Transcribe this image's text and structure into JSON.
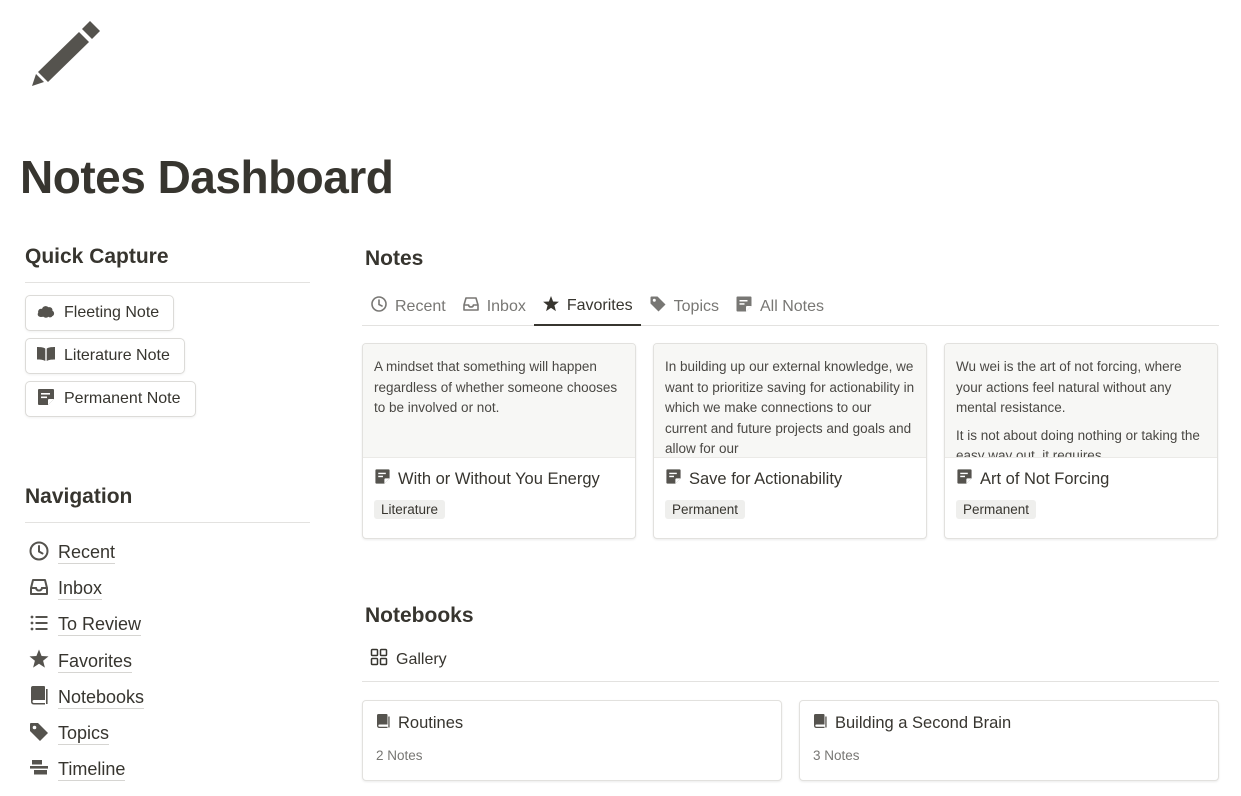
{
  "page": {
    "icon": "pencil-icon",
    "title": "Notes Dashboard"
  },
  "quick_capture": {
    "heading": "Quick Capture",
    "buttons": [
      {
        "label": "Fleeting Note",
        "icon": "cloud-icon"
      },
      {
        "label": "Literature Note",
        "icon": "book-open-icon"
      },
      {
        "label": "Permanent Note",
        "icon": "sticky-note-icon"
      }
    ]
  },
  "navigation": {
    "heading": "Navigation",
    "items": [
      {
        "label": "Recent",
        "icon": "clock-icon"
      },
      {
        "label": "Inbox",
        "icon": "inbox-tray-icon"
      },
      {
        "label": "To Review",
        "icon": "list-icon"
      },
      {
        "label": "Favorites",
        "icon": "star-icon"
      },
      {
        "label": "Notebooks",
        "icon": "notebook-icon"
      },
      {
        "label": "Topics",
        "icon": "tag-icon"
      },
      {
        "label": "Timeline",
        "icon": "timeline-icon"
      }
    ]
  },
  "notes": {
    "heading": "Notes",
    "tabs": [
      {
        "label": "Recent",
        "icon": "clock-icon",
        "active": false
      },
      {
        "label": "Inbox",
        "icon": "inbox-tray-icon",
        "active": false
      },
      {
        "label": "Favorites",
        "icon": "star-icon",
        "active": true
      },
      {
        "label": "Topics",
        "icon": "tag-icon",
        "active": false
      },
      {
        "label": "All Notes",
        "icon": "sticky-note-icon",
        "active": false
      }
    ],
    "cards": [
      {
        "preview": [
          "A mindset that something will happen regardless of whether someone chooses to be involved or not."
        ],
        "title": "With or Without You Energy",
        "tag": "Literature"
      },
      {
        "preview": [
          "In building up our external knowledge, we want to prioritize saving for actionability in which we make connections to our current and future projects and goals and allow for our"
        ],
        "title": "Save for Actionability",
        "tag": "Permanent"
      },
      {
        "preview": [
          "Wu wei is the art of not forcing, where your actions feel natural without any mental resistance.",
          "It is not about doing nothing or taking the easy way out, it requires"
        ],
        "title": "Art of Not Forcing",
        "tag": "Permanent"
      }
    ]
  },
  "notebooks": {
    "heading": "Notebooks",
    "view_tab": "Gallery",
    "cards": [
      {
        "title": "Routines",
        "count": "2 Notes"
      },
      {
        "title": "Building a Second Brain",
        "count": "3 Notes"
      }
    ]
  },
  "colors": {
    "text": "#37352f",
    "muted": "#787774",
    "icon": "#55534e",
    "border": "#e3e2e0"
  }
}
